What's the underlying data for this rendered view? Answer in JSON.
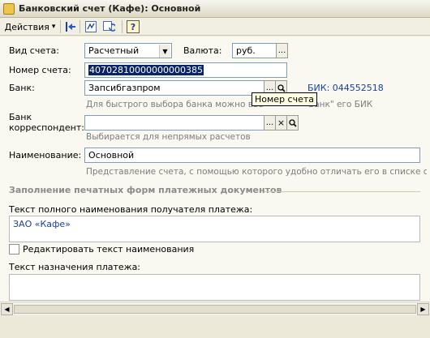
{
  "window": {
    "title": "Банковский счет (Кафе): Основной"
  },
  "toolbar": {
    "actions_label": "Действия",
    "actions_arrow": "▾",
    "help_label": "?"
  },
  "form": {
    "account_type": {
      "label": "Вид счета:",
      "value": "Расчетный"
    },
    "currency": {
      "label": "Валюта:",
      "value": "руб."
    },
    "account_number": {
      "label": "Номер счета:",
      "value": "40702810000000000385"
    },
    "bank": {
      "label": "Банк:",
      "value": "Запсибгазпром",
      "bik": "БИК: 044552518",
      "hint": "Для быстрого выбора банка можно вве",
      "hint_tail": "Банк\" его БИК"
    },
    "correspondent_bank": {
      "label_line1": "Банк",
      "label_line2": "корреспондент:",
      "value": "",
      "hint": "Выбирается для непрямых расчетов"
    },
    "name": {
      "label": "Наименование:",
      "value": "Основной",
      "hint": "Представление счета, с помощью которого удобно отличать его в списке счетов"
    },
    "print_section": {
      "title": "Заполнение печатных форм платежных документов",
      "recipient_label": "Текст полного наименования получателя платежа:",
      "recipient_value": "ЗАО «Кафе»",
      "edit_checkbox_label": "Редактировать текст наименования",
      "edit_checked": false,
      "purpose_label": "Текст назначения платежа:",
      "purpose_value": ""
    },
    "buttons": {
      "select": "...",
      "clear": "×",
      "open": "🔍"
    }
  },
  "tooltip": {
    "text": "Номер счета"
  },
  "colors": {
    "bik": "#1a3f9c",
    "link_recipient": "#1a3f9c",
    "selection": "#0a246a"
  }
}
